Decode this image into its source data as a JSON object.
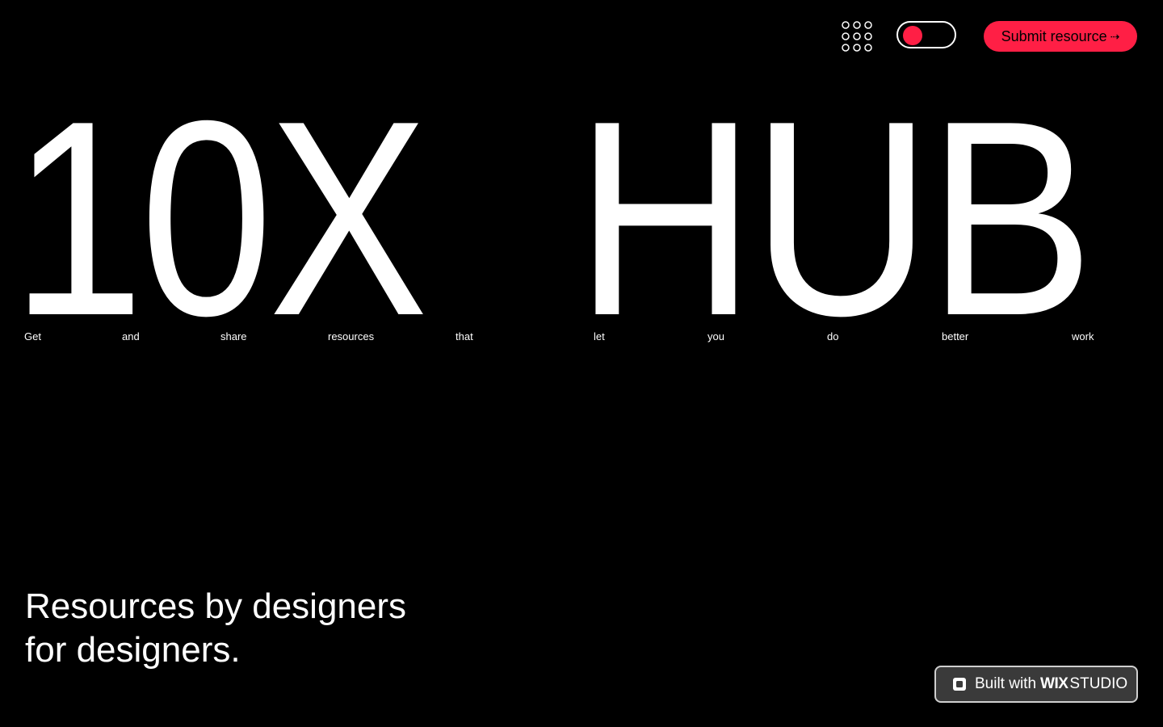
{
  "header": {
    "menu_icon": "grid-dots-icon",
    "theme_toggle": {
      "state": "on",
      "knob_color": "#ff1f45"
    },
    "submit_button": {
      "label": "Submit resource",
      "icon": "arrow-right-icon",
      "icon_glyph": "⇢",
      "color": "#ff1f45"
    }
  },
  "hero": {
    "title_part_1": "10X",
    "title_part_2": "HUB",
    "tagline_words": [
      "Get",
      "and",
      "share",
      "resources",
      "that",
      "let",
      "you",
      "do",
      "better",
      "work"
    ]
  },
  "subheading": {
    "line_1": "Resources by designers",
    "line_2": "for designers."
  },
  "badge": {
    "prefix": "Built with",
    "brand": "WIX",
    "product": "STUDIO",
    "icon": "square-icon"
  },
  "colors": {
    "background": "#000000",
    "text": "#ffffff",
    "accent": "#ff1f45"
  }
}
